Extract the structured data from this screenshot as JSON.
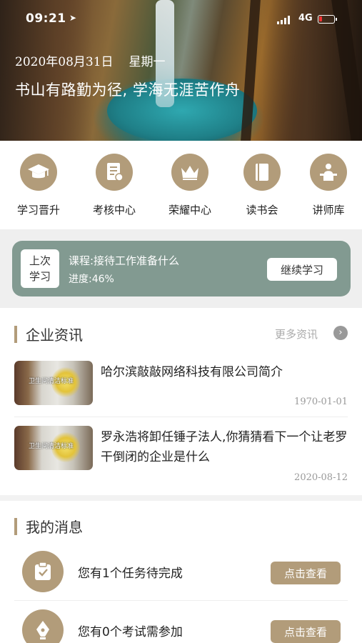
{
  "status_bar": {
    "time": "09:21",
    "network": "4G"
  },
  "hero": {
    "date": "2020年08月31日",
    "weekday": "星期一",
    "motto": "书山有路勤为径, 学海无涯苦作舟"
  },
  "quick_nav": [
    {
      "label": "学习晋升",
      "icon": "graduation-cap-icon"
    },
    {
      "label": "考核中心",
      "icon": "exam-paper-icon"
    },
    {
      "label": "荣耀中心",
      "icon": "crown-icon"
    },
    {
      "label": "读书会",
      "icon": "book-icon"
    },
    {
      "label": "讲师库",
      "icon": "lecturer-icon"
    }
  ],
  "continue_card": {
    "tag_line1": "上次",
    "tag_line2": "学习",
    "course": "课程:接待工作准备什么",
    "progress": "进度:46%",
    "button": "继续学习"
  },
  "news": {
    "title": "企业资讯",
    "more": "更多资讯",
    "items": [
      {
        "headline": "哈尔滨敲敲网络科技有限公司简介",
        "date": "1970-01-01",
        "thumb_caption": "卫生间清洁标准"
      },
      {
        "headline": "罗永浩将卸任锤子法人,你猜猜看下一个让老罗干倒闭的企业是什么",
        "date": "2020-08-12",
        "thumb_caption": "卫生间清洁标准"
      }
    ]
  },
  "messages": {
    "title": "我的消息",
    "items": [
      {
        "text": "您有1个任务待完成",
        "button": "点击查看",
        "icon": "task-check-icon"
      },
      {
        "text": "您有0个考试需参加",
        "button": "点击查看",
        "icon": "pen-nib-icon"
      }
    ]
  },
  "colors": {
    "accent": "#b29c7a",
    "card": "#829a91"
  }
}
